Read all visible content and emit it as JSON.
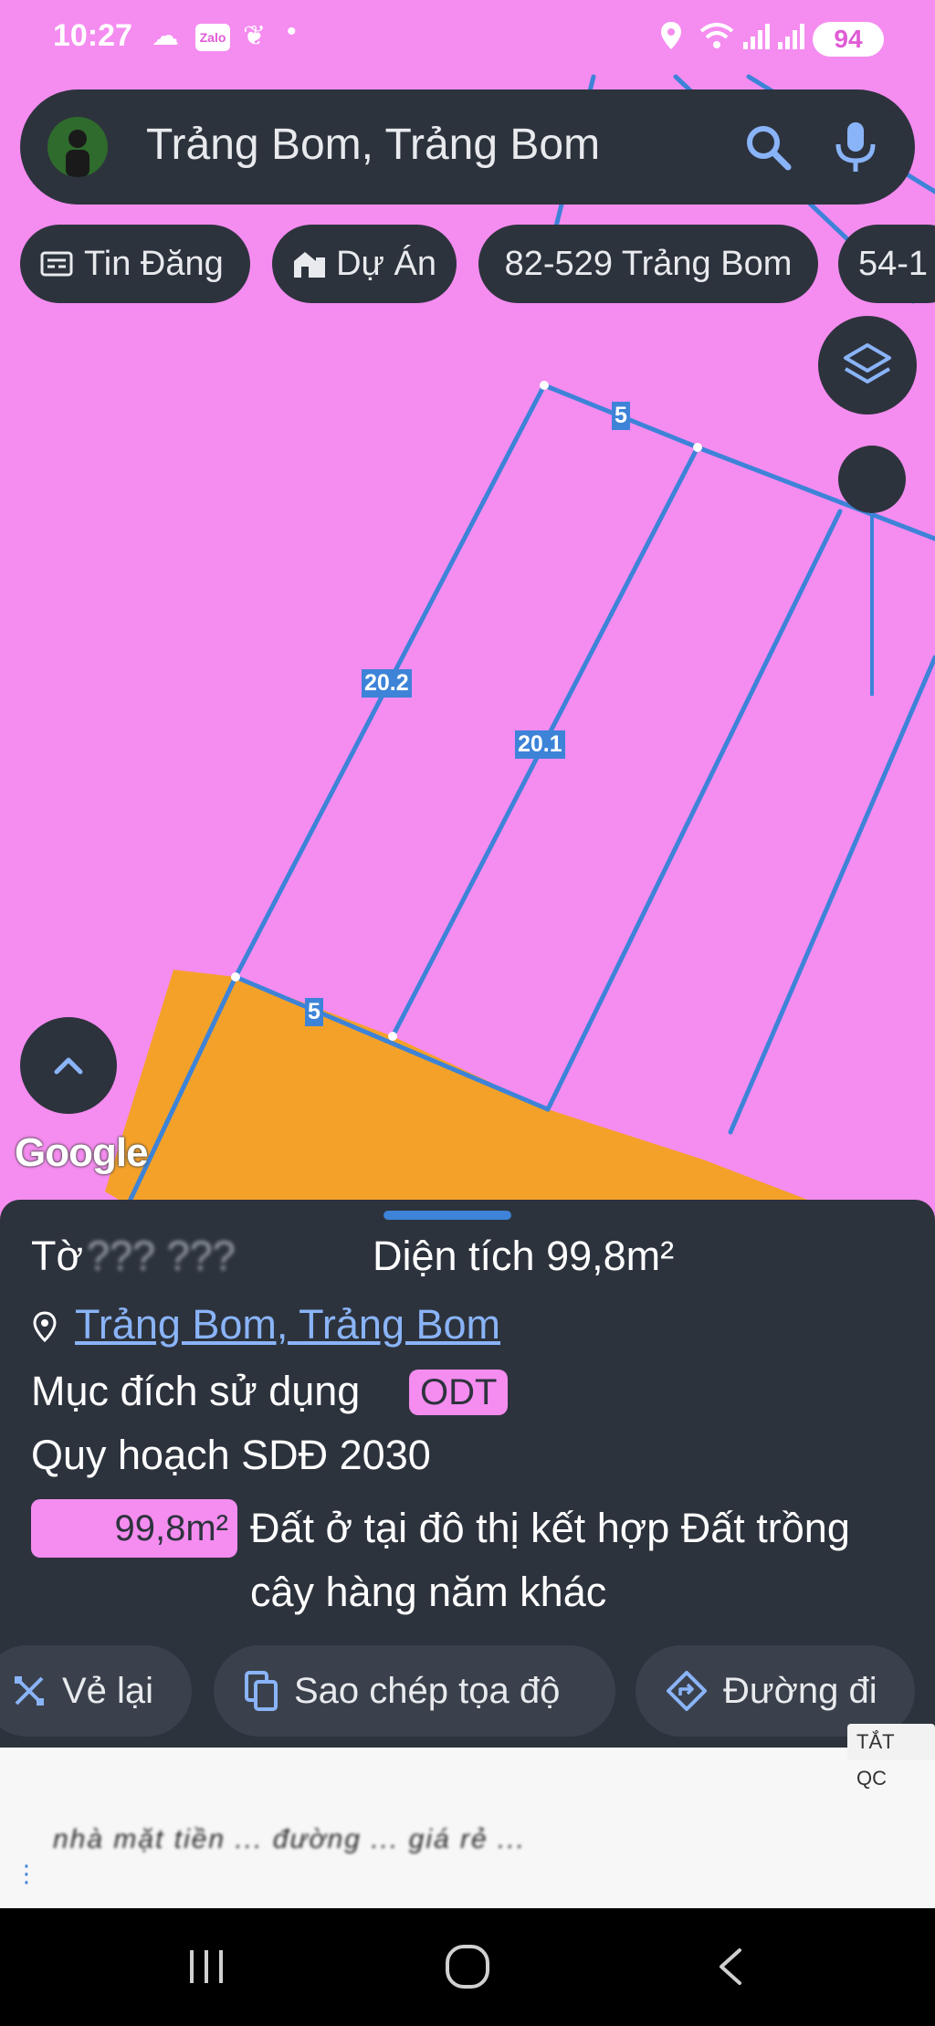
{
  "status_bar": {
    "time": "10:27",
    "battery": "94",
    "icons": [
      "cloud-icon",
      "zalo-icon",
      "leaf-icon",
      "dot-icon",
      "location-icon",
      "wifi-icon",
      "signal-icon",
      "signal-icon-2",
      "battery-icon"
    ]
  },
  "search": {
    "query": "Trảng Bom, Trảng Bom"
  },
  "chips": [
    {
      "label": "Tin Đăng",
      "icon": "newspaper-icon"
    },
    {
      "label": "Dự Án",
      "icon": "building-icon"
    },
    {
      "label": "82-529 Trảng Bom",
      "icon": ""
    },
    {
      "label": "54-1",
      "icon": ""
    }
  ],
  "map": {
    "land_color": "#f58cf0",
    "highlight_color": "#f4a12a",
    "boundary_color": "#3d83d8",
    "labels": {
      "side_top": "5",
      "side_left": "20.2",
      "side_right": "20.1",
      "side_bottom": "5"
    },
    "attribution": "Google"
  },
  "sheet": {
    "title_prefix": "Tờ",
    "title_obscured": "??? ???",
    "area_label": "Diện tích 99,8m²",
    "address": "Trảng Bom, Trảng Bom",
    "purpose_label": "Mục đích sử dụng",
    "purpose_code": "ODT",
    "planning_label": "Quy hoạch SDĐ 2030",
    "plan_area": "99,8m²",
    "plan_desc_line1": "Đất ở tại đô thị kết hợp Đất trồng",
    "plan_desc_line2": "cây hàng năm khác"
  },
  "actions": [
    {
      "label": "Vẻ lại",
      "icon": "redraw-icon"
    },
    {
      "label": "Sao chép tọa độ",
      "icon": "copy-icon"
    },
    {
      "label": "Đường đi",
      "icon": "directions-icon"
    }
  ],
  "ad": {
    "close_label": "TẮT QC",
    "text": "nhà mặt tiền ... đường ... giá rẻ ..."
  },
  "nav": {
    "icons": [
      "recents-icon",
      "home-icon",
      "back-icon"
    ]
  }
}
